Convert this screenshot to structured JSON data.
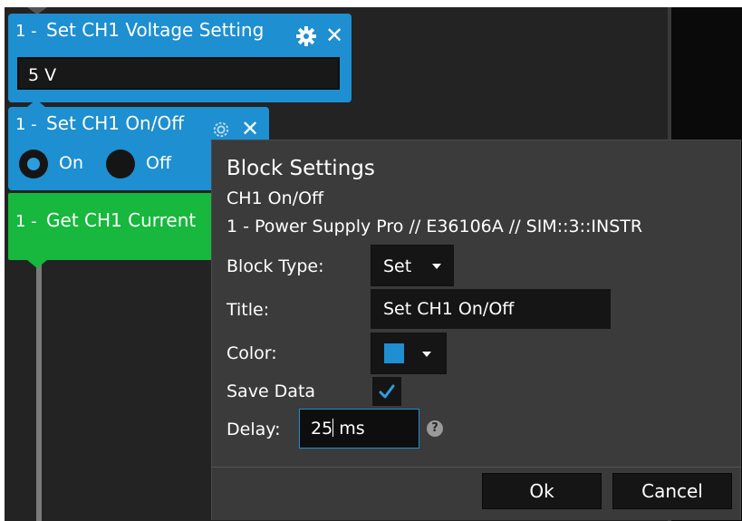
{
  "blocks": [
    {
      "number": "1 -",
      "title": "Set CH1 Voltage Setting",
      "value": "5 V"
    },
    {
      "number": "1 -",
      "title": "Set CH1 On/Off",
      "options": [
        "On",
        "Off"
      ],
      "selected": "On"
    },
    {
      "number": "1 -",
      "title": "Get CH1 Current"
    }
  ],
  "dialog": {
    "title": "Block Settings",
    "subtitle": "CH1 On/Off",
    "device": "1 - Power Supply Pro // E36106A // SIM::3::INSTR",
    "block_type_label": "Block Type:",
    "block_type_value": "Set",
    "title_label": "Title:",
    "title_value": "Set CH1 On/Off",
    "color_label": "Color:",
    "color_value": "#1e8fd0",
    "save_data_label": "Save Data",
    "save_data_checked": true,
    "delay_label": "Delay:",
    "delay_value": "25",
    "delay_unit": "ms",
    "help_glyph": "?",
    "ok_label": "Ok",
    "cancel_label": "Cancel"
  },
  "colors": {
    "set_block": "#1e8fd0",
    "get_block": "#17b83d",
    "canvas": "#232323",
    "dialog_bg": "#3b3b3b"
  },
  "icons": [
    "gear-icon",
    "close-icon",
    "chevron-down-icon",
    "checkmark-icon",
    "help-icon"
  ]
}
